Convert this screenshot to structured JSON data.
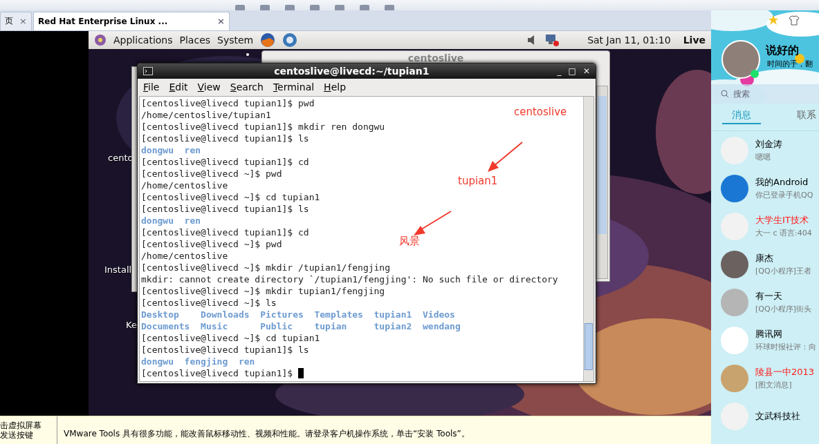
{
  "browser_tabs": [
    {
      "label": "页",
      "close": "×",
      "selected": false
    },
    {
      "label": "Red Hat Enterprise Linux ...",
      "close": "×",
      "selected": true
    }
  ],
  "gnome_panel": {
    "menus": [
      "Applications",
      "Places",
      "System"
    ],
    "clock": "Sat Jan 11, 01:10",
    "user": "Live"
  },
  "desktop_labels": [
    "cento",
    "Install",
    "Ke"
  ],
  "back_window": {
    "title": "centoslive"
  },
  "terminal": {
    "title": "centoslive@livecd:~/tupian1",
    "menu": [
      "File",
      "Edit",
      "View",
      "Search",
      "Terminal",
      "Help"
    ],
    "window_buttons": [
      "_",
      "□",
      "✕"
    ],
    "cursor": true,
    "lines": [
      {
        "kind": "text",
        "text": "[centoslive@livecd tupian1]$ pwd"
      },
      {
        "kind": "text",
        "text": "/home/centoslive/tupian1"
      },
      {
        "kind": "text",
        "text": "[centoslive@livecd tupian1]$ mkdir ren dongwu"
      },
      {
        "kind": "text",
        "text": "[centoslive@livecd tupian1]$ ls"
      },
      {
        "kind": "listing",
        "text": "dongwu  ren"
      },
      {
        "kind": "text",
        "text": "[centoslive@livecd tupian1]$ cd"
      },
      {
        "kind": "text",
        "text": "[centoslive@livecd ~]$ pwd"
      },
      {
        "kind": "text",
        "text": "/home/centoslive"
      },
      {
        "kind": "text",
        "text": "[centoslive@livecd ~]$ cd tupian1"
      },
      {
        "kind": "text",
        "text": "[centoslive@livecd tupian1]$ ls"
      },
      {
        "kind": "listing",
        "text": "dongwu  ren"
      },
      {
        "kind": "text",
        "text": "[centoslive@livecd tupian1]$ cd"
      },
      {
        "kind": "text",
        "text": "[centoslive@livecd ~]$ pwd"
      },
      {
        "kind": "text",
        "text": "/home/centoslive"
      },
      {
        "kind": "text",
        "text": "[centoslive@livecd ~]$ mkdir /tupian1/fengjing"
      },
      {
        "kind": "text",
        "text": "mkdir: cannot create directory `/tupian1/fengjing': No such file or directory"
      },
      {
        "kind": "text",
        "text": "[centoslive@livecd ~]$ mkdir tupian1/fengjing"
      },
      {
        "kind": "text",
        "text": "[centoslive@livecd ~]$ ls"
      },
      {
        "kind": "listing",
        "text": "Desktop    Downloads  Pictures  Templates  tupian1  Videos"
      },
      {
        "kind": "listing",
        "text": "Documents  Music      Public    tupian     tupian2  wendang"
      },
      {
        "kind": "text",
        "text": "[centoslive@livecd ~]$ cd tupian1"
      },
      {
        "kind": "text",
        "text": "[centoslive@livecd tupian1]$ ls"
      },
      {
        "kind": "listing",
        "text": "dongwu  fengjing  ren"
      },
      {
        "kind": "text",
        "text": "[centoslive@livecd tupian1]$ "
      }
    ]
  },
  "annotations": [
    "centoslive",
    "tupian1",
    "风景"
  ],
  "qq": {
    "nickname": "说好的",
    "signature": "时间的手，翻",
    "search": {
      "placeholder": "搜索"
    },
    "tabs": [
      {
        "label": "消息",
        "selected": true
      },
      {
        "label": "联系",
        "selected": false
      }
    ],
    "chats": [
      {
        "name": "刘金涛",
        "preview": "嗯嗯",
        "highlighted": false
      },
      {
        "name": "我的Android",
        "preview": "你已登录手机QQ",
        "highlighted": false
      },
      {
        "name": "大学生IT技术",
        "preview": "大一 c 语言:404",
        "highlighted": true
      },
      {
        "name": "康杰",
        "preview": "[QQ小程序]王者",
        "highlighted": false
      },
      {
        "name": "有一天",
        "preview": "[QQ小程序]街头",
        "highlighted": false
      },
      {
        "name": "腾讯网",
        "preview": "环球时报社评：向",
        "highlighted": false
      },
      {
        "name": "陵县一中2013",
        "preview": "[图文消息]",
        "highlighted": true
      },
      {
        "name": "文武科技社",
        "highlighted": false
      }
    ]
  },
  "bottom_bar": {
    "hint_lines": [
      "击虚拟屏幕",
      "发送按键"
    ],
    "message": "VMware Tools 具有很多功能，能改善鼠标移动性、视频和性能。请登录客户机操作系统，单击“安装 Tools”。"
  }
}
